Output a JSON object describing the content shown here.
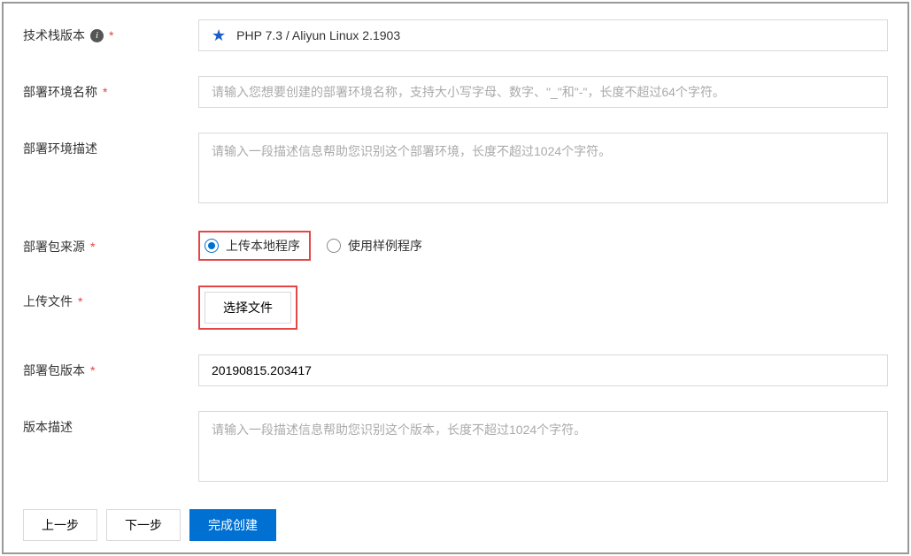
{
  "labels": {
    "stack_version": "技术栈版本",
    "env_name": "部署环境名称",
    "env_desc": "部署环境描述",
    "pkg_source": "部署包来源",
    "upload_file": "上传文件",
    "pkg_version": "部署包版本",
    "version_desc": "版本描述"
  },
  "stack": {
    "value": "PHP 7.3 / Aliyun Linux 2.1903"
  },
  "placeholders": {
    "env_name": "请输入您想要创建的部署环境名称，支持大小写字母、数字、\"_\"和\"-\"，长度不超过64个字符。",
    "env_desc": "请输入一段描述信息帮助您识别这个部署环境，长度不超过1024个字符。",
    "version_desc": "请输入一段描述信息帮助您识别这个版本，长度不超过1024个字符。"
  },
  "pkg_source": {
    "upload_local": "上传本地程序",
    "use_sample": "使用样例程序"
  },
  "file_select_label": "选择文件",
  "pkg_version_value": "20190815.203417",
  "buttons": {
    "prev": "上一步",
    "next": "下一步",
    "finish": "完成创建"
  }
}
